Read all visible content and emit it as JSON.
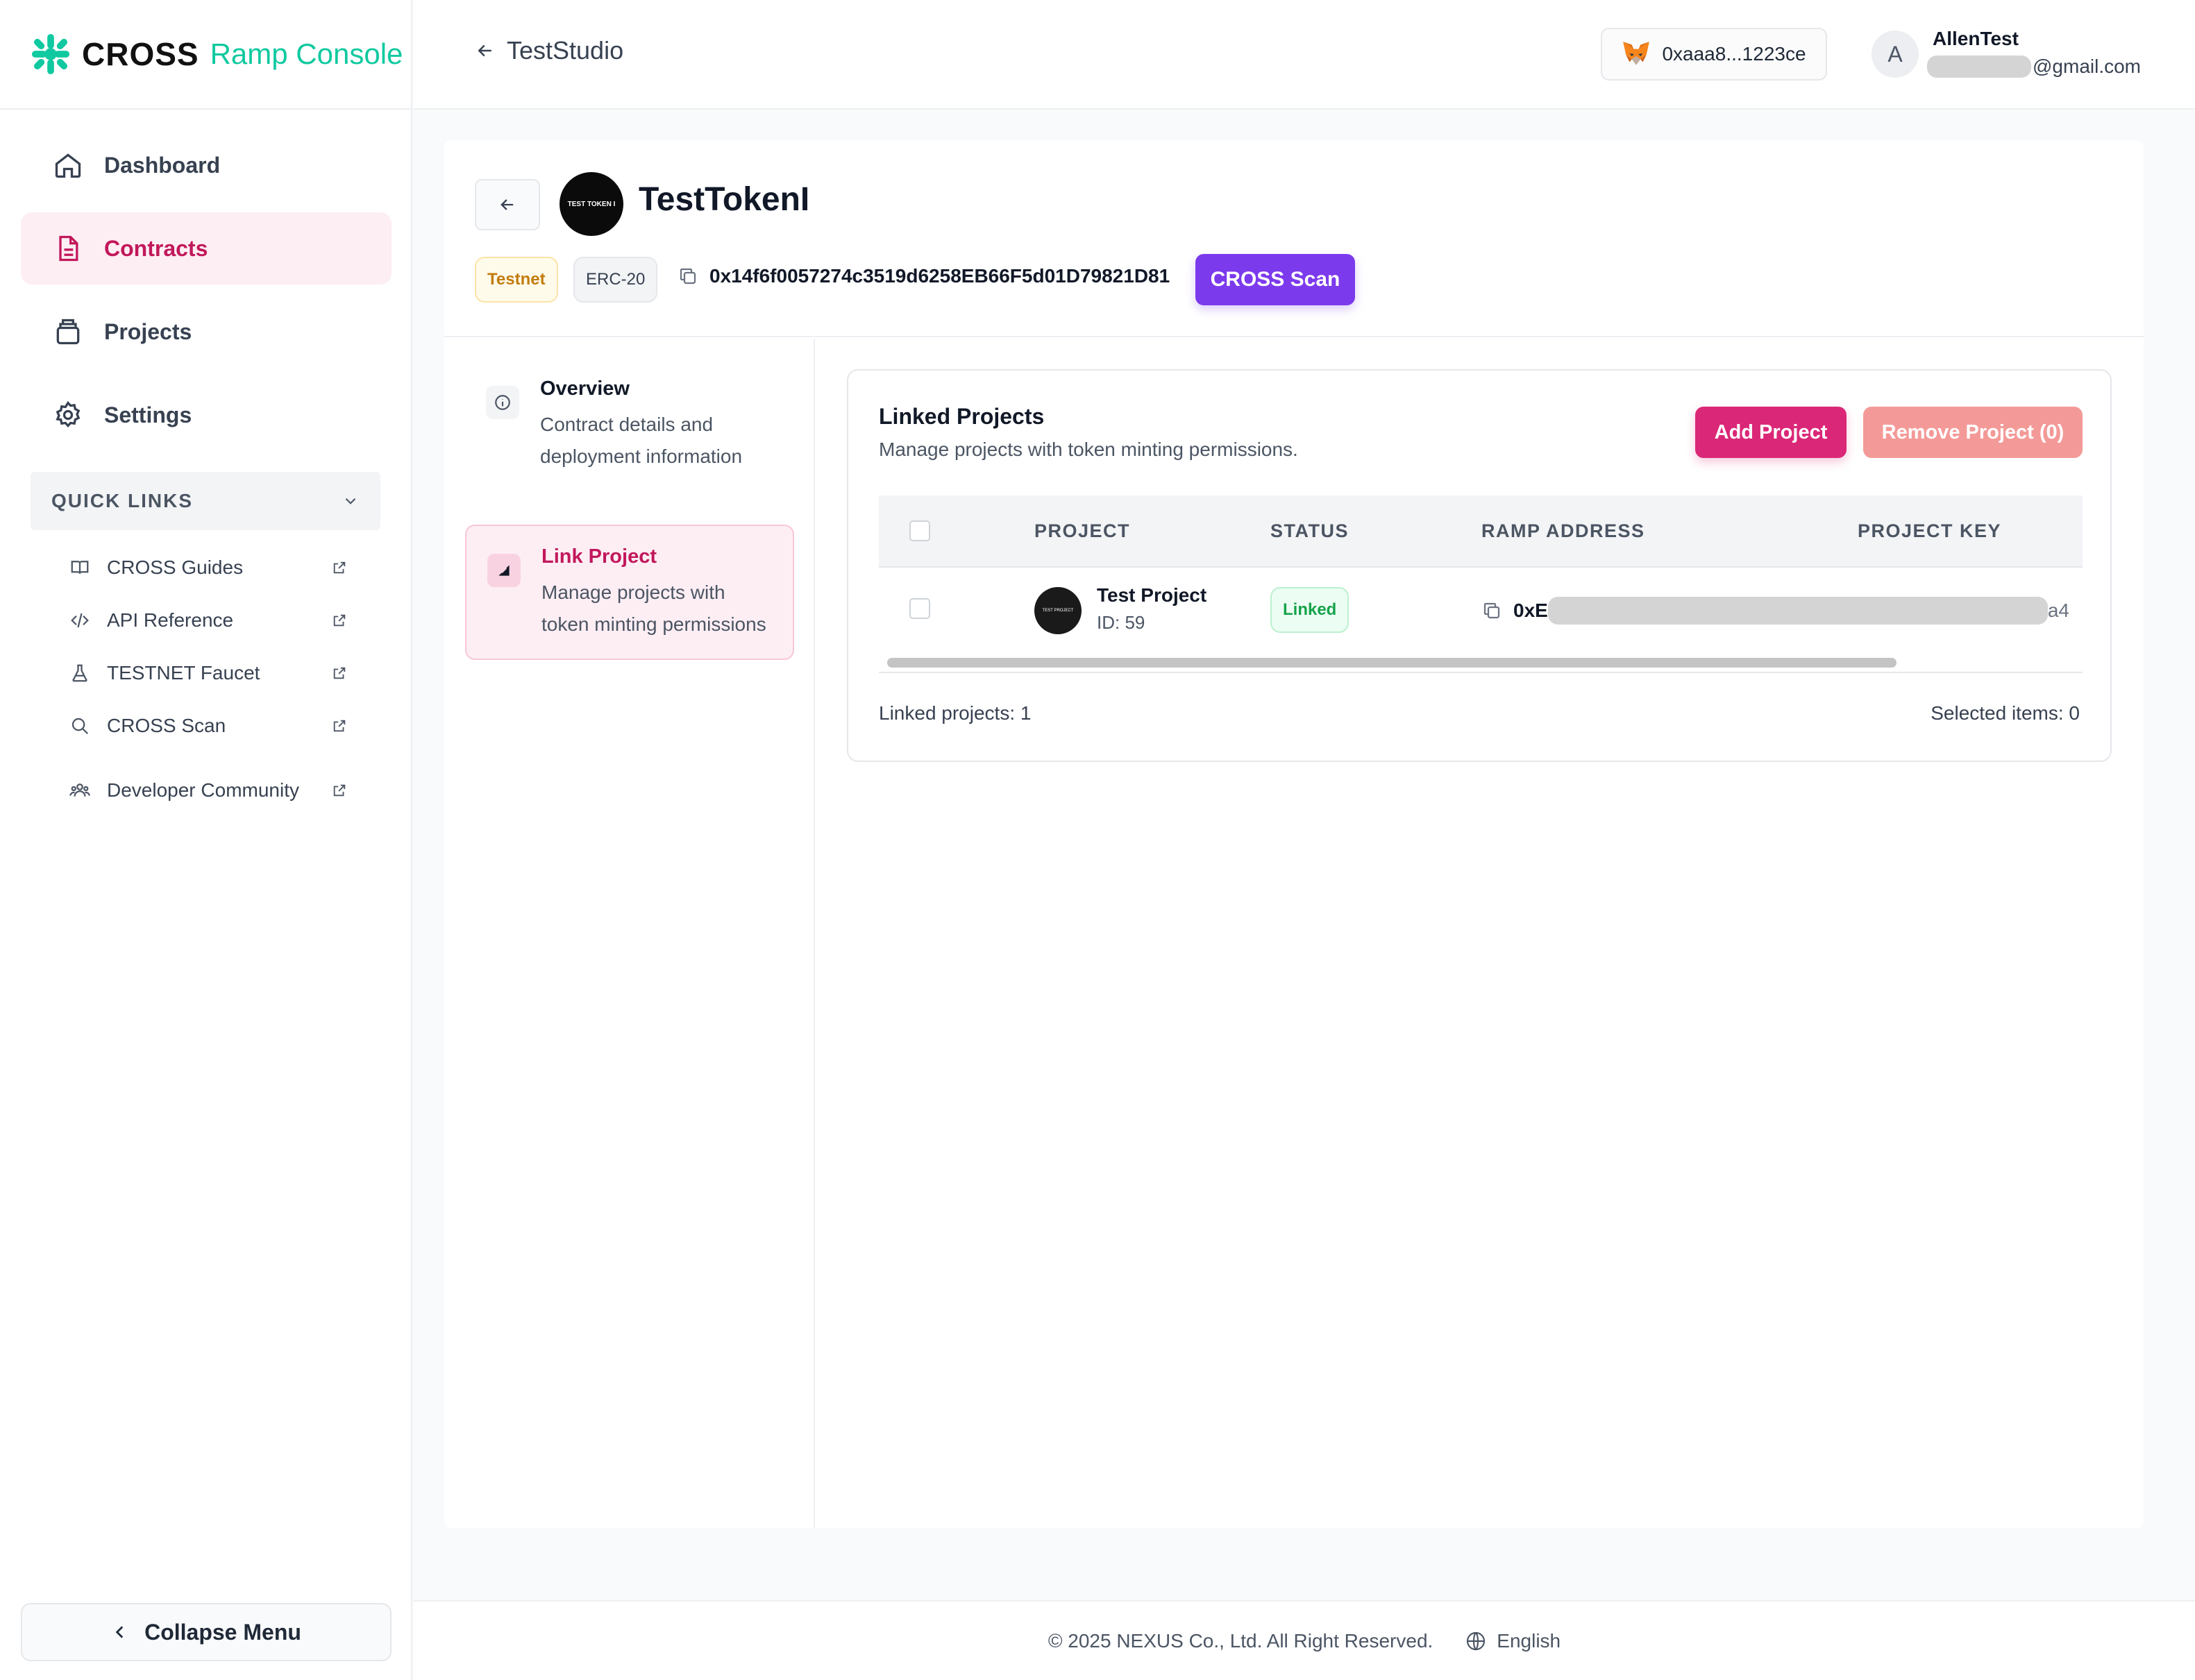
{
  "brand": {
    "cross": "CROSS",
    "rest": "Ramp Console",
    "accent": "#10c9a0"
  },
  "sidebar": {
    "items": [
      {
        "label": "Dashboard",
        "icon": "home-icon",
        "active": false
      },
      {
        "label": "Contracts",
        "icon": "document-icon",
        "active": true
      },
      {
        "label": "Projects",
        "icon": "folder-icon",
        "active": false
      },
      {
        "label": "Settings",
        "icon": "gear-icon",
        "active": false
      }
    ],
    "quick_links_title": "QUICK LINKS",
    "quick_links": [
      {
        "label": "CROSS Guides",
        "icon": "book-icon"
      },
      {
        "label": "API Reference",
        "icon": "code-icon"
      },
      {
        "label": "TESTNET Faucet",
        "icon": "flask-icon"
      },
      {
        "label": "CROSS Scan",
        "icon": "search-icon"
      },
      {
        "label": "Developer Community",
        "icon": "community-icon"
      }
    ],
    "collapse_label": "Collapse Menu"
  },
  "header": {
    "studio": "TestStudio",
    "wallet": "0xaaa8...1223ce",
    "avatar_initial": "A",
    "user_name": "AllenTest",
    "user_email_suffix": "@gmail.com"
  },
  "token": {
    "logo_text": "TEST TOKEN I",
    "name": "TestTokenI",
    "network_badge": "Testnet",
    "standard_badge": "ERC-20",
    "address": "0x14f6f0057274c3519d6258EB66F5d01D79821D81",
    "scan_button": "CROSS Scan"
  },
  "steps": [
    {
      "title": "Overview",
      "desc": "Contract details and deployment information",
      "icon": "info-icon",
      "active": false
    },
    {
      "title": "Link Project",
      "desc": "Manage projects with token minting permissions",
      "icon": "link-project-icon",
      "active": true
    }
  ],
  "linked": {
    "title": "Linked Projects",
    "subtitle": "Manage projects with token minting permissions.",
    "add_button": "Add Project",
    "remove_button": "Remove Project (0)",
    "columns": [
      "PROJECT",
      "STATUS",
      "RAMP ADDRESS",
      "PROJECT KEY"
    ],
    "rows": [
      {
        "logo_text": "TEST PROJECT",
        "name": "Test Project",
        "id": "ID: 59",
        "status": "Linked",
        "ramp_prefix": "0xE",
        "ramp_suffix": "a4"
      }
    ],
    "count_label": "Linked projects: 1",
    "selected_label": "Selected items: 0"
  },
  "footer": {
    "copyright": "© 2025 NEXUS Co., Ltd. All Right Reserved.",
    "language": "English"
  }
}
